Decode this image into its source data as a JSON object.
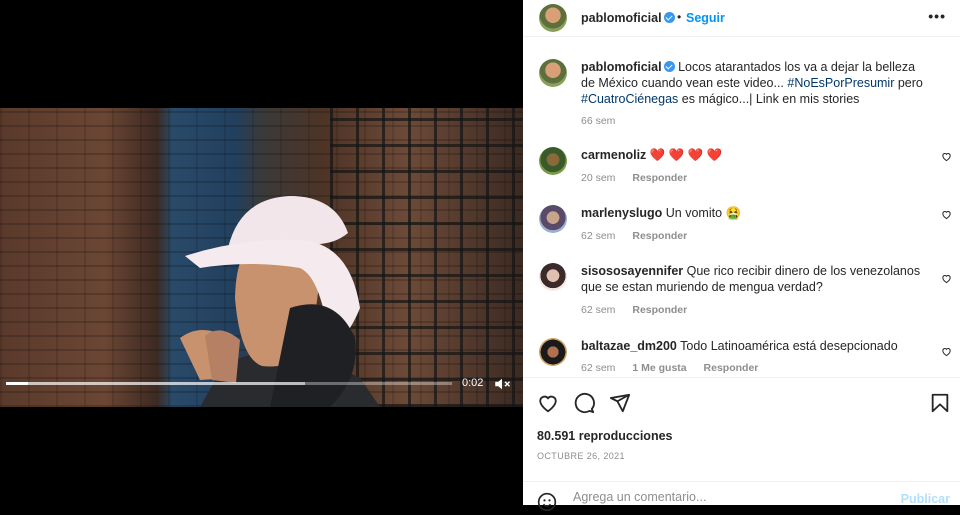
{
  "video": {
    "time": "0:02",
    "progress": 0.05,
    "buffered": 0.67
  },
  "post": {
    "author": "pablomoficial",
    "separator": "•",
    "follow_label": "Seguir",
    "more_label": "•••",
    "caption_text_1": "Locos atarantados los va a dejar la belleza de México cuando vean este video...",
    "hashtag_1": "#NoEsPorPresumir",
    "caption_text_2": "pero",
    "hashtag_2": "#CuatroCiénegas",
    "caption_text_3": "es mágico...| Link en mis stories",
    "caption_time": "66 sem"
  },
  "comments": [
    {
      "user": "carmenoliz",
      "text": "❤️ ❤️ ❤️ ❤️",
      "time": "20 sem",
      "reply": "Responder"
    },
    {
      "user": "marlenyslugo",
      "text": "Un vomito 🤮",
      "time": "62 sem",
      "reply": "Responder"
    },
    {
      "user": "sisososayennifer",
      "text": "Que rico recibir dinero de los venezolanos que se estan muriendo de mengua verdad?",
      "time": "62 sem",
      "reply": "Responder"
    },
    {
      "user": "baltazae_dm200",
      "text": "Todo Latinoamérica está desepcionado",
      "time": "62 sem",
      "likes": "1 Me gusta",
      "reply": "Responder"
    }
  ],
  "stats": {
    "views": "80.591 reproducciones",
    "date": "OCTUBRE 26, 2021"
  },
  "composer": {
    "placeholder": "Agrega un comentario...",
    "publish_label": "Publicar"
  },
  "colors": {
    "accent": "#0095f6",
    "publish_disabled": "#b2dffc",
    "verified": "#3897f0"
  }
}
